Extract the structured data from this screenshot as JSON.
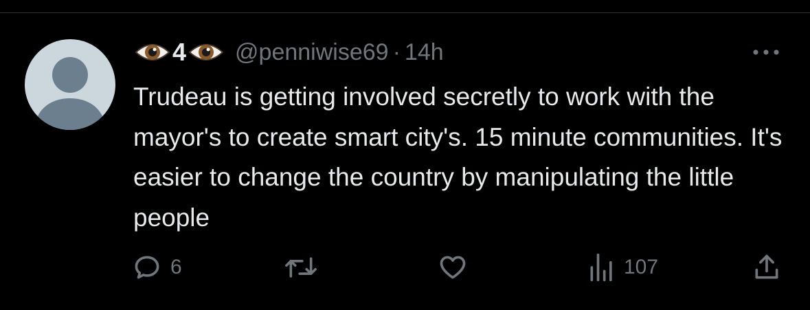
{
  "tweet": {
    "display_name_digit": "4",
    "handle": "@penniwise69",
    "separator": "·",
    "time": "14h",
    "text": "Trudeau is getting involved secretly to work with the mayor's to create smart city's. 15 minute communities. It's easier to change the country by manipulating the little people"
  },
  "actions": {
    "reply_count": "6",
    "views_count": "107"
  },
  "icons": {
    "avatar": "default-avatar-icon",
    "name_emoji": "eye-emoji-icon",
    "more": "more-icon",
    "reply": "reply-icon",
    "retweet": "retweet-icon",
    "like": "heart-icon",
    "views": "views-icon",
    "share": "share-icon"
  },
  "colors": {
    "background": "#000000",
    "text": "#e7e9ea",
    "muted": "#71767b",
    "avatar_bg": "#ccd6dd",
    "avatar_fg": "#6b7f8e"
  }
}
